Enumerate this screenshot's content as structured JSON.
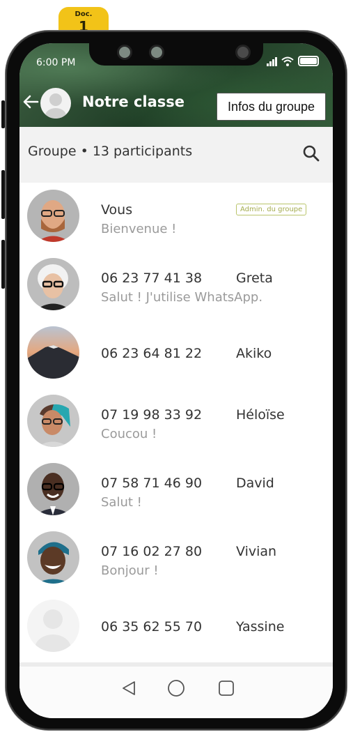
{
  "doc_tab": {
    "label": "Doc.",
    "number": "1"
  },
  "status_bar": {
    "time": "6:00 PM"
  },
  "header": {
    "title": "Notre classe",
    "info_button": "Infos du groupe"
  },
  "group_bar": {
    "summary": "Groupe • 13 participants"
  },
  "participants": [
    {
      "name": "Vous",
      "status": "Bienvenue !",
      "badge": "Admin. du groupe"
    },
    {
      "phone": "06 23 77 41 38",
      "name": "Greta",
      "status": "Salut ! J'utilise WhatsApp."
    },
    {
      "phone": "06 23 64 81 22",
      "name": "Akiko",
      "status": ""
    },
    {
      "phone": "07 19 98 33 92",
      "name": "Héloïse",
      "status": "Coucou !"
    },
    {
      "phone": "07 58 71 46 90",
      "name": "David",
      "status": "Salut !"
    },
    {
      "phone": "07 16 02 27 80",
      "name": "Vivian",
      "status": "Bonjour !"
    },
    {
      "phone": "06 35 62 55 70",
      "name": "Yassine",
      "status": ""
    }
  ],
  "icons": {
    "back": "arrow-left-icon",
    "search": "search-icon",
    "nav_back": "triangle-back-icon",
    "nav_home": "circle-home-icon",
    "nav_recents": "square-recents-icon"
  },
  "colors": {
    "header_green": "#2e5133",
    "doc_tab": "#f2c318",
    "badge": "#a4ac4f"
  }
}
